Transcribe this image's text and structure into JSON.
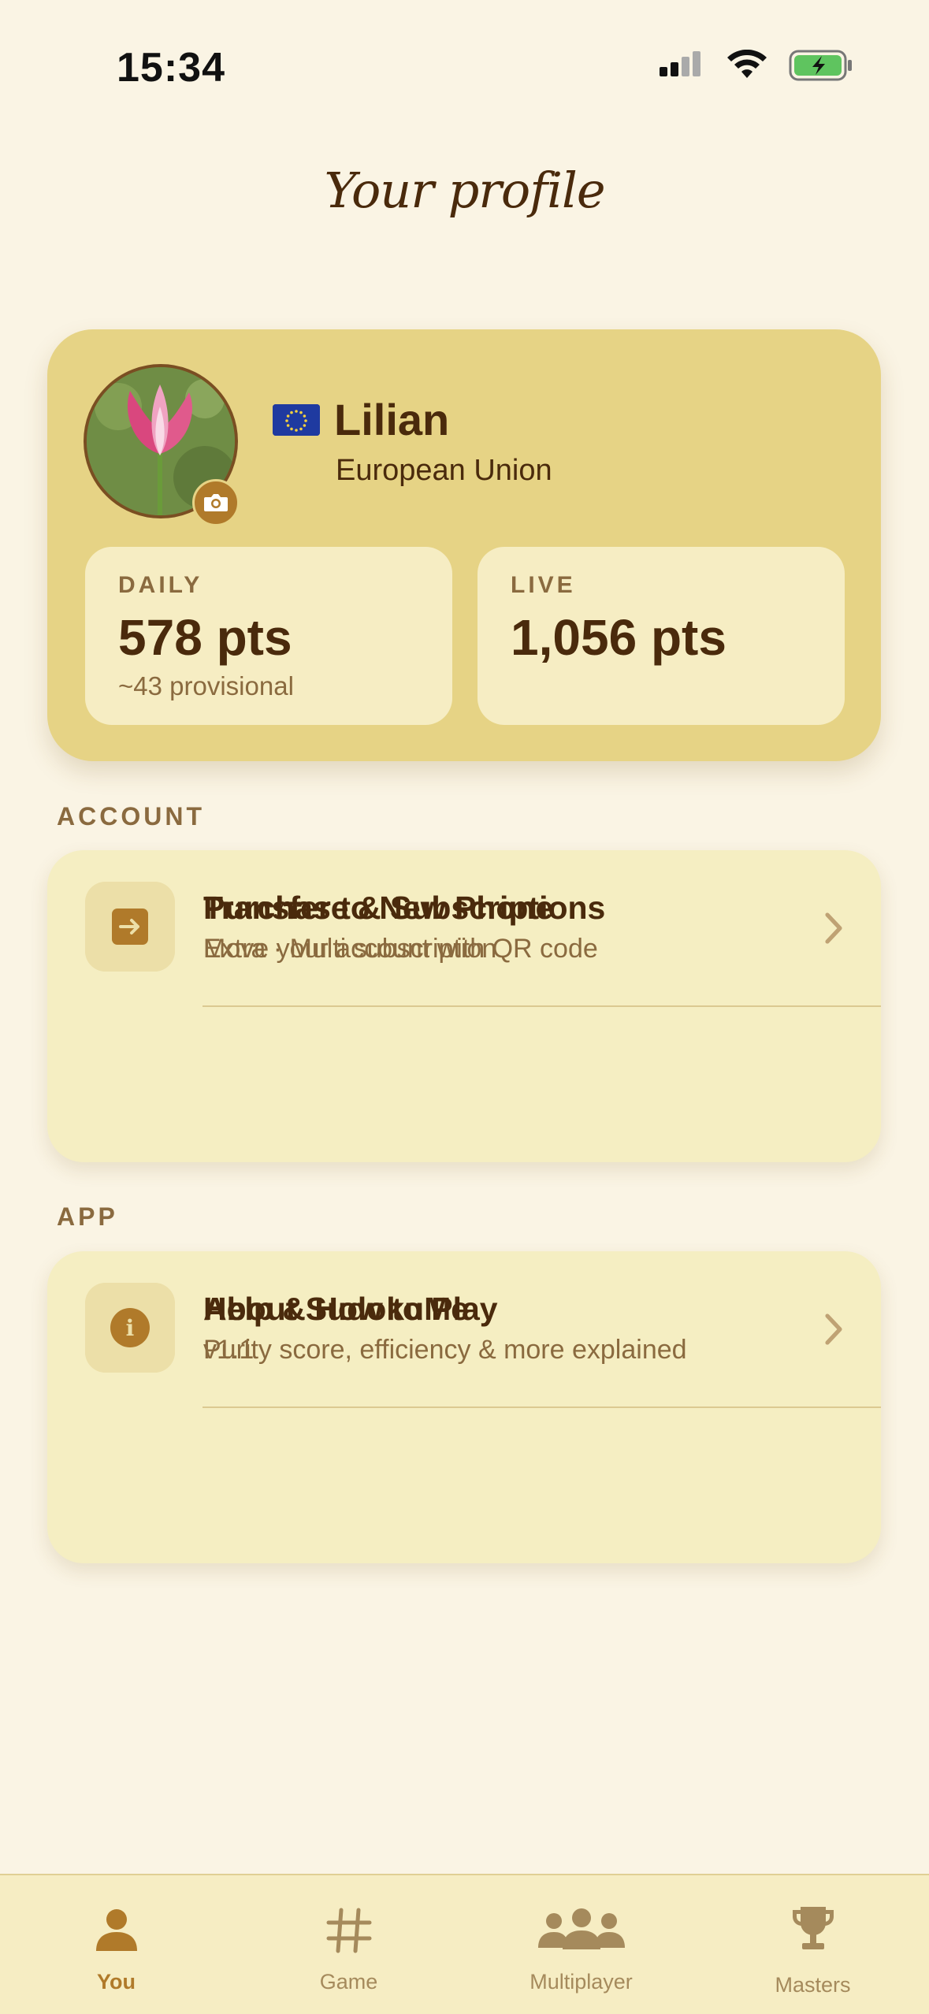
{
  "status_bar": {
    "time": "15:34"
  },
  "page": {
    "title": "Your profile"
  },
  "profile": {
    "name": "Lilian",
    "country": "European Union",
    "flag_icon": "eu-flag-icon",
    "stats": {
      "daily": {
        "label": "DAILY",
        "value": "578 pts",
        "sub": "~43 provisional"
      },
      "live": {
        "label": "LIVE",
        "value": "1,056 pts"
      }
    }
  },
  "sections": {
    "account": {
      "label": "ACCOUNT",
      "items": [
        {
          "title": "Purchase & Subscriptions",
          "subtitle": "Extra · Multi subscription",
          "icon": "credit-card-icon"
        },
        {
          "title": "Transfer to New Phone",
          "subtitle": "Move your account with QR code",
          "icon": "transfer-icon"
        }
      ]
    },
    "app": {
      "label": "APP",
      "items": [
        {
          "title": "Help & How to Play",
          "subtitle": "Purity score, efficiency & more explained",
          "icon": "help-icon"
        },
        {
          "title": "About SudokuMe",
          "subtitle": "v1.1",
          "icon": "info-icon"
        }
      ]
    }
  },
  "tab_bar": {
    "tabs": [
      {
        "label": "You",
        "icon": "person-icon",
        "active": true
      },
      {
        "label": "Game",
        "icon": "grid-icon",
        "active": false
      },
      {
        "label": "Multiplayer",
        "icon": "group-icon",
        "active": false
      },
      {
        "label": "Masters",
        "icon": "trophy-icon",
        "active": false
      }
    ]
  },
  "colors": {
    "background": "#faf4e4",
    "profile_card": "#e6d385",
    "list_card": "#f5eec2",
    "accent": "#b07a2a",
    "text_dark": "#4a2a0c",
    "text_muted": "#8a6a3f"
  }
}
